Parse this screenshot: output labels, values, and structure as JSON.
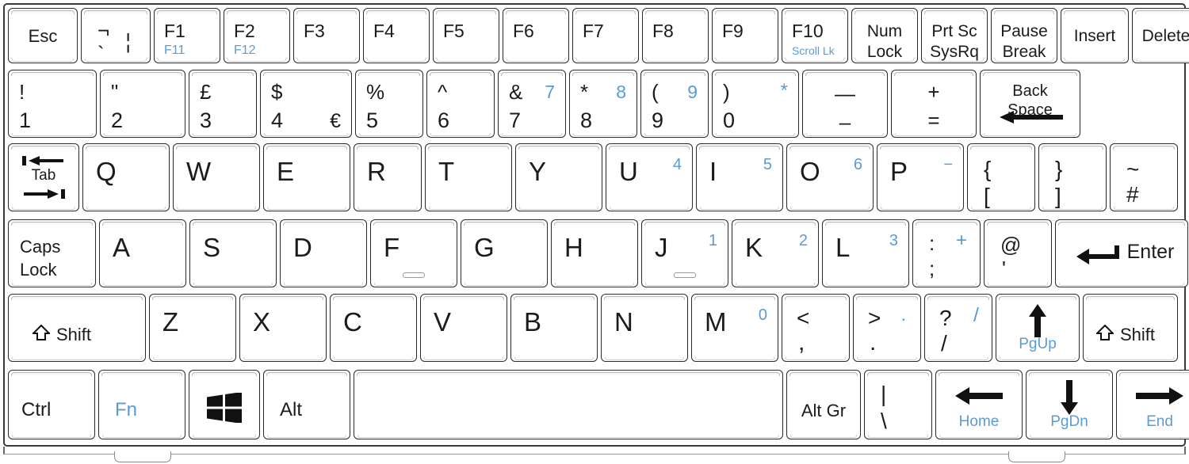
{
  "device": {
    "name": "laptop-keyboard",
    "layout": "UK QWERTY",
    "accent_blue": "#5b9bd5",
    "key_text_color": "#1b1b1b",
    "background": "#ffffff"
  },
  "rows": {
    "function_row": [
      {
        "name": "esc",
        "main": "Esc"
      },
      {
        "name": "grave",
        "main": "",
        "glyphs": [
          "¬",
          "`",
          "|"
        ]
      },
      {
        "name": "f1",
        "main": "F1",
        "sub": "F11"
      },
      {
        "name": "f2",
        "main": "F2",
        "sub": "F12"
      },
      {
        "name": "f3",
        "main": "F3"
      },
      {
        "name": "f4",
        "main": "F4"
      },
      {
        "name": "f5",
        "main": "F5"
      },
      {
        "name": "f6",
        "main": "F6"
      },
      {
        "name": "f7",
        "main": "F7"
      },
      {
        "name": "f8",
        "main": "F8"
      },
      {
        "name": "f9",
        "main": "F9"
      },
      {
        "name": "f10",
        "main": "F10",
        "sub": "Scroll Lk"
      },
      {
        "name": "num-lock",
        "line1": "Num",
        "line2": "Lock"
      },
      {
        "name": "print-screen",
        "line1": "Prt Sc",
        "line2": "SysRq"
      },
      {
        "name": "pause",
        "line1": "Pause",
        "line2": "Break"
      },
      {
        "name": "insert",
        "main": "Insert"
      },
      {
        "name": "delete",
        "main": "Delete"
      }
    ],
    "number_row": [
      {
        "name": "key-1",
        "shift": "!",
        "base": "1"
      },
      {
        "name": "key-2",
        "shift": "\"",
        "base": "2"
      },
      {
        "name": "key-3",
        "shift": "£",
        "base": "3"
      },
      {
        "name": "key-4",
        "shift": "$",
        "base": "4",
        "altgr": "€"
      },
      {
        "name": "key-5",
        "shift": "%",
        "base": "5"
      },
      {
        "name": "key-6",
        "shift": "^",
        "base": "6"
      },
      {
        "name": "key-7",
        "shift": "&",
        "base": "7",
        "numpad": "7"
      },
      {
        "name": "key-8",
        "shift": "*",
        "base": "8",
        "numpad": "8"
      },
      {
        "name": "key-9",
        "shift": "(",
        "base": "9",
        "numpad": "9"
      },
      {
        "name": "key-0",
        "shift": ")",
        "base": "0",
        "numpad": "*"
      },
      {
        "name": "key-minus",
        "shift": "—",
        "base": "–"
      },
      {
        "name": "key-equals",
        "shift": "+",
        "base": "="
      },
      {
        "name": "backspace",
        "line1": "Back",
        "line2": "Space"
      }
    ],
    "qwerty_row": [
      {
        "name": "tab",
        "main": "Tab"
      },
      {
        "name": "key-q",
        "letter": "Q"
      },
      {
        "name": "key-w",
        "letter": "W"
      },
      {
        "name": "key-e",
        "letter": "E"
      },
      {
        "name": "key-r",
        "letter": "R"
      },
      {
        "name": "key-t",
        "letter": "T"
      },
      {
        "name": "key-y",
        "letter": "Y"
      },
      {
        "name": "key-u",
        "letter": "U",
        "numpad": "4"
      },
      {
        "name": "key-i",
        "letter": "I",
        "numpad": "5"
      },
      {
        "name": "key-o",
        "letter": "O",
        "numpad": "6"
      },
      {
        "name": "key-p",
        "letter": "P",
        "numpad": "−"
      },
      {
        "name": "key-bracket-left",
        "shift": "{",
        "base": "["
      },
      {
        "name": "key-bracket-right",
        "shift": "}",
        "base": "]"
      },
      {
        "name": "key-hash",
        "shift": "~",
        "base": "#"
      }
    ],
    "home_row": [
      {
        "name": "caps-lock",
        "line1": "Caps",
        "line2": "Lock"
      },
      {
        "name": "key-a",
        "letter": "A"
      },
      {
        "name": "key-s",
        "letter": "S"
      },
      {
        "name": "key-d",
        "letter": "D"
      },
      {
        "name": "key-f",
        "letter": "F",
        "homing": true
      },
      {
        "name": "key-g",
        "letter": "G"
      },
      {
        "name": "key-h",
        "letter": "H"
      },
      {
        "name": "key-j",
        "letter": "J",
        "numpad": "1",
        "homing": true
      },
      {
        "name": "key-k",
        "letter": "K",
        "numpad": "2"
      },
      {
        "name": "key-l",
        "letter": "L",
        "numpad": "3"
      },
      {
        "name": "key-semicolon",
        "shift": ":",
        "base": ";",
        "numpad": "+"
      },
      {
        "name": "key-apostrophe",
        "shift": "@",
        "base": "'"
      },
      {
        "name": "enter",
        "main": "Enter"
      }
    ],
    "zxcv_row": [
      {
        "name": "shift-left",
        "main": "Shift"
      },
      {
        "name": "key-z",
        "letter": "Z"
      },
      {
        "name": "key-x",
        "letter": "X"
      },
      {
        "name": "key-c",
        "letter": "C"
      },
      {
        "name": "key-v",
        "letter": "V"
      },
      {
        "name": "key-b",
        "letter": "B"
      },
      {
        "name": "key-n",
        "letter": "N"
      },
      {
        "name": "key-m",
        "letter": "M",
        "numpad": "0"
      },
      {
        "name": "key-comma",
        "shift": "<",
        "base": ","
      },
      {
        "name": "key-period",
        "shift": ">",
        "base": ".",
        "numpad": "."
      },
      {
        "name": "key-slash",
        "shift": "?",
        "base": "/",
        "numpad": "/"
      },
      {
        "name": "arrow-up",
        "sub": "PgUp"
      },
      {
        "name": "shift-right",
        "main": "Shift"
      }
    ],
    "bottom_row": [
      {
        "name": "ctrl",
        "main": "Ctrl"
      },
      {
        "name": "fn",
        "main": "Fn"
      },
      {
        "name": "windows",
        "main": ""
      },
      {
        "name": "alt",
        "main": "Alt"
      },
      {
        "name": "space",
        "main": ""
      },
      {
        "name": "alt-gr",
        "main": "Alt Gr"
      },
      {
        "name": "key-backslash",
        "shift": "|",
        "base": "\\"
      },
      {
        "name": "arrow-left",
        "sub": "Home"
      },
      {
        "name": "arrow-down",
        "sub": "PgDn"
      },
      {
        "name": "arrow-right",
        "sub": "End"
      }
    ]
  }
}
